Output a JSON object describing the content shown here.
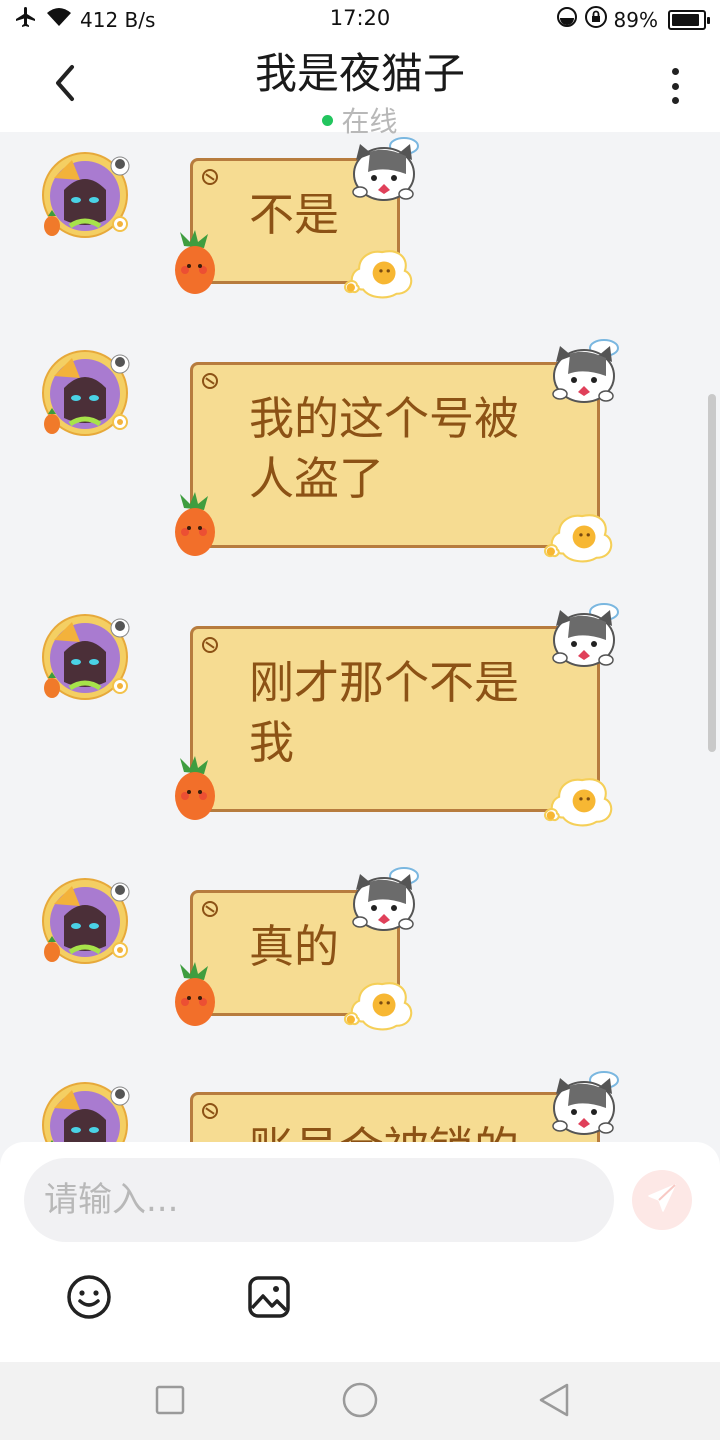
{
  "status_bar": {
    "speed": "412 B/s",
    "time": "17:20",
    "battery_percent": "89%",
    "battery_level": 0.89,
    "icons": [
      "airplane-icon",
      "wifi-icon",
      "do-not-disturb-icon",
      "rotation-lock-icon",
      "battery-icon"
    ]
  },
  "header": {
    "title": "我是夜猫子",
    "status": "在线",
    "status_color": "#22c55e"
  },
  "messages": [
    {
      "text": "不是"
    },
    {
      "text": "我的这个号被人盗了"
    },
    {
      "text": "刚才那个不是我"
    },
    {
      "text": "真的"
    },
    {
      "text": "账号会被锁的"
    }
  ],
  "input": {
    "placeholder": "请输入..."
  },
  "toolbar": {
    "icons": [
      "emoji-icon",
      "image-icon",
      "send-icon"
    ]
  },
  "colors": {
    "bubble_fill": "#f6dc92",
    "bubble_border": "#b77c3e",
    "bubble_text": "#8c5215",
    "send_button": "#fde8e6"
  }
}
